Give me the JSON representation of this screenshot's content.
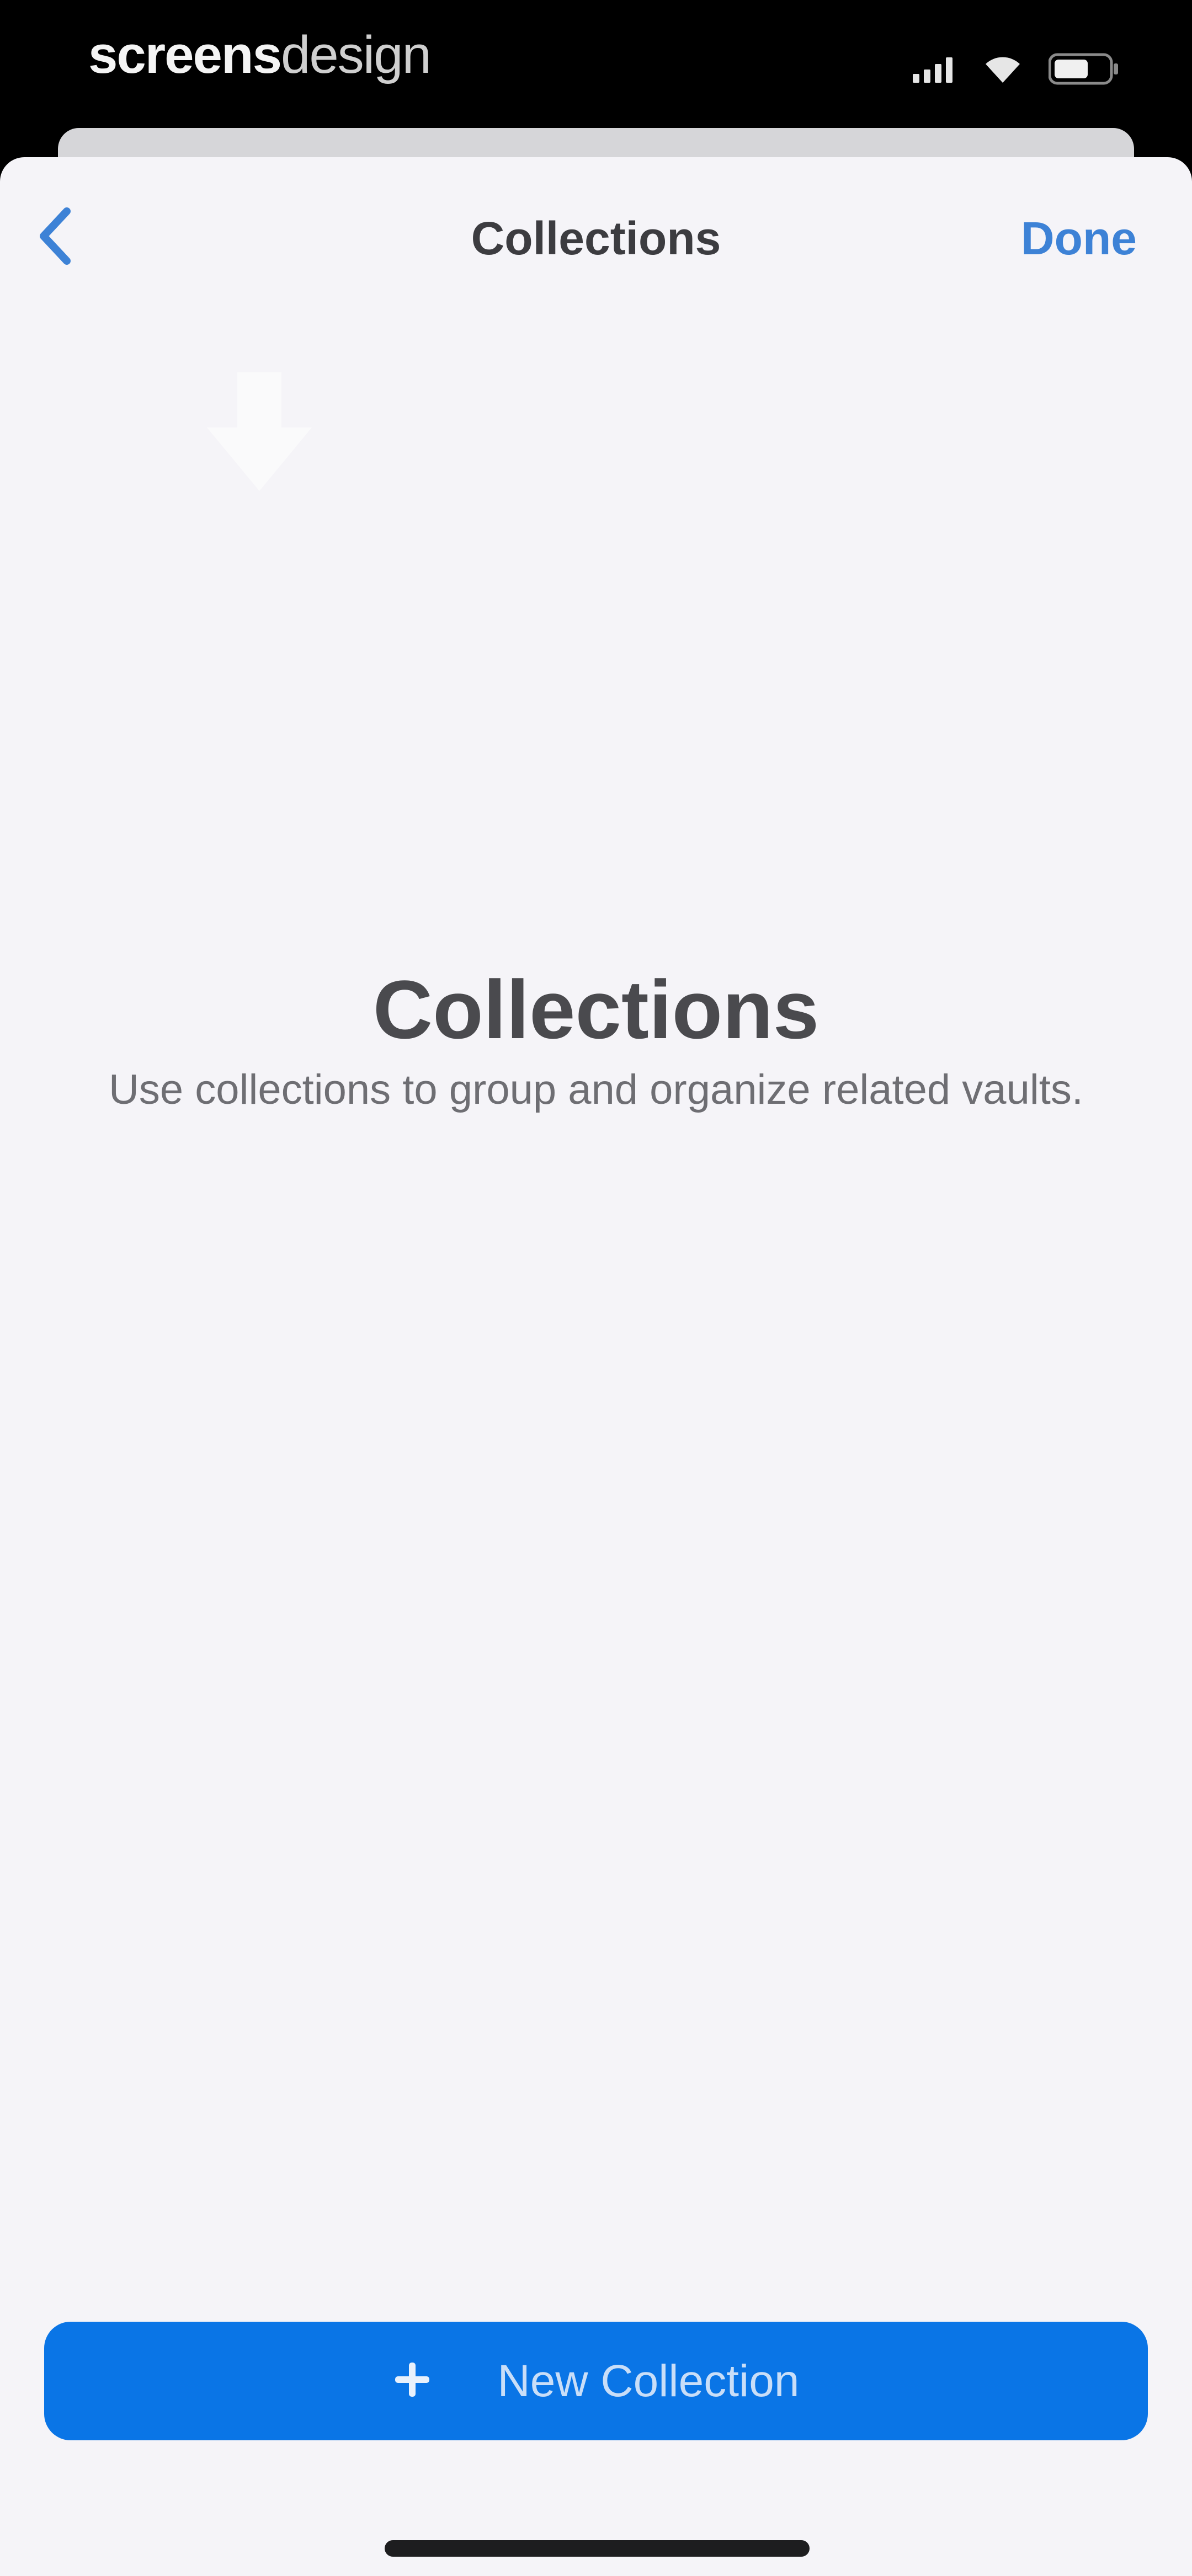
{
  "status_bar": {
    "watermark_part1": "screens",
    "watermark_part2": "design",
    "icons": [
      "signal-icon",
      "wifi-icon",
      "battery-icon"
    ]
  },
  "nav": {
    "back_icon": "chevron-left-icon",
    "title": "Collections",
    "done_label": "Done"
  },
  "empty_state": {
    "title": "Collections",
    "subtitle": "Use collections to group and organize related vaults."
  },
  "actions": {
    "new_collection_icon": "plus-icon",
    "new_collection_label": "New Collection"
  },
  "colors": {
    "accent": "#0a75e6",
    "link": "#3d82d6",
    "sheet_background": "#f5f4f8"
  }
}
